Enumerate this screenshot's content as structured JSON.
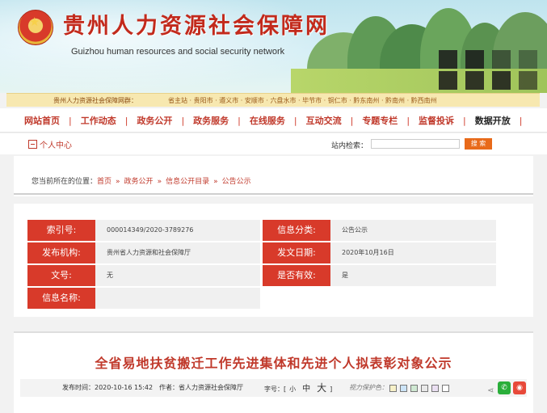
{
  "header": {
    "title": "贵州人力资源社会保障网",
    "subtitle": "Guizhou human resources and social security network"
  },
  "cities": {
    "label": "贵州人力资源社会保障网群：",
    "list": "省主站 · 贵阳市 · 遵义市 · 安顺市 · 六盘水市 · 毕节市 · 铜仁市 · 黔东南州 · 黔南州 · 黔西南州"
  },
  "nav": {
    "items": [
      "网站首页",
      "工作动态",
      "政务公开",
      "政务服务",
      "在线服务",
      "互动交流",
      "专题专栏",
      "监督投诉",
      "数据开放"
    ]
  },
  "toolbar": {
    "personal_center": "个人中心",
    "search_label": "站内检索：",
    "search_value": "",
    "search_button": "搜 索"
  },
  "breadcrumb": {
    "lead": "您当前所在的位置：",
    "items": [
      "首页",
      "政务公开",
      "信息公开目录",
      "公告公示"
    ]
  },
  "info": {
    "index_label": "索引号:",
    "index_value": "000014349/2020-3789276",
    "category_label": "信息分类:",
    "category_value": "公告公示",
    "org_label": "发布机构:",
    "org_value": "贵州省人力资源和社会保障厅",
    "date_label": "发文日期:",
    "date_value": "2020年10月16日",
    "docno_label": "文号:",
    "docno_value": "无",
    "valid_label": "是否有效:",
    "valid_value": "是",
    "name_label": "信息名称:",
    "name_value": ""
  },
  "article": {
    "title": "全省易地扶贫搬迁工作先进集体和先进个人拟表彰对象公示",
    "publish_time": "发布时间：2020-10-16 15:42",
    "author": "作者：省人力资源社会保障厅",
    "font_size_label": "字号：",
    "size_small": "小",
    "size_medium": "中",
    "size_large": "大",
    "eye_care_label": "视力保护色：",
    "swatch_colors": [
      "#f7f1c8",
      "#cce4f7",
      "#cfe8d2",
      "#e8e8e8",
      "#eadff2",
      "#ffffff"
    ]
  }
}
